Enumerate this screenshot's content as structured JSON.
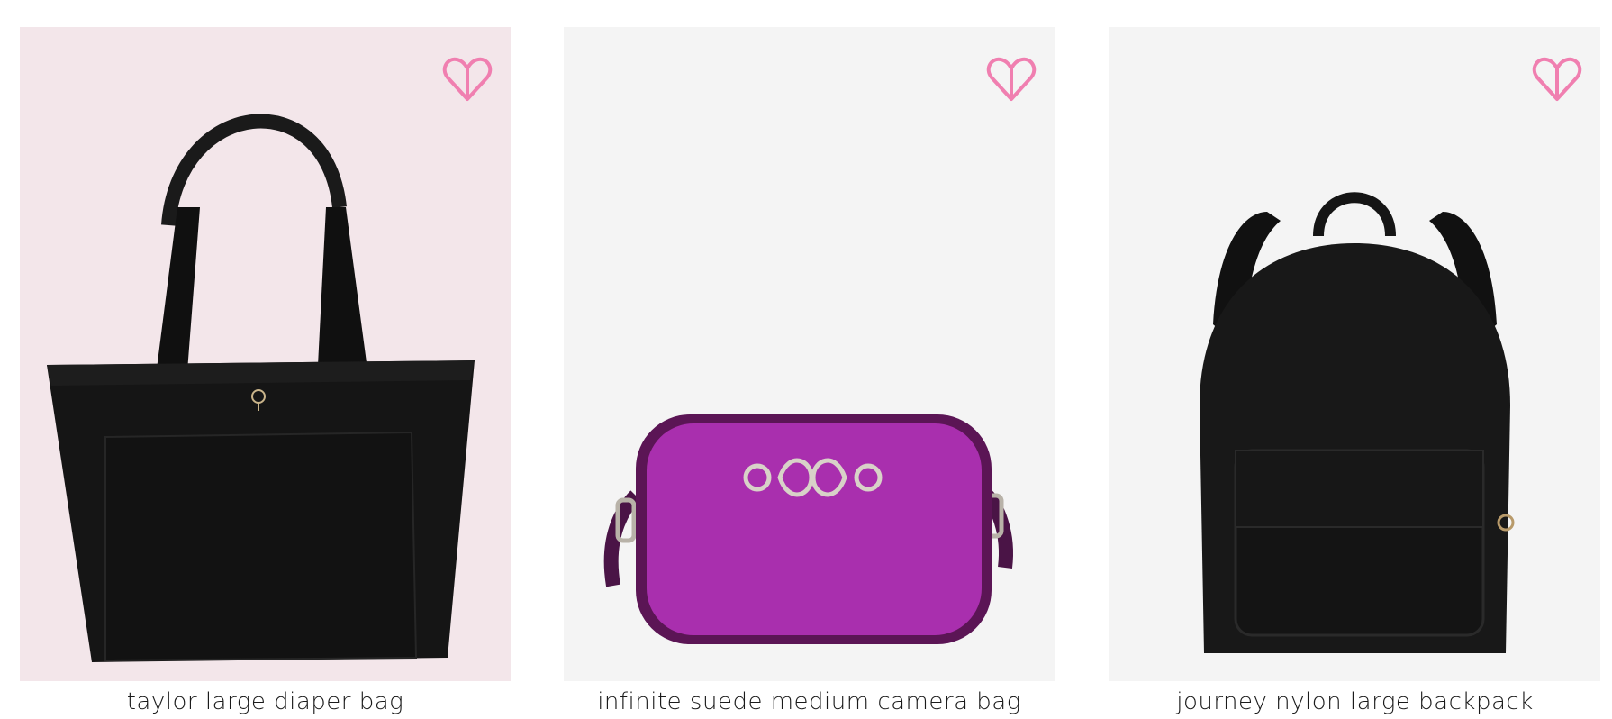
{
  "products": [
    {
      "name": "taylor large diaper bag",
      "tile_bg": "#f3e6ea",
      "item_color": "#161616",
      "wishlist_icon": "heart-outline-icon"
    },
    {
      "name": "infinite suede medium camera bag",
      "tile_bg": "#f4f4f4",
      "item_color": "#a92fae",
      "wishlist_icon": "heart-outline-icon"
    },
    {
      "name": "journey nylon large backpack",
      "tile_bg": "#f4f4f4",
      "item_color": "#181818",
      "wishlist_icon": "heart-outline-icon"
    }
  ],
  "accent_color": "#f07fb0"
}
